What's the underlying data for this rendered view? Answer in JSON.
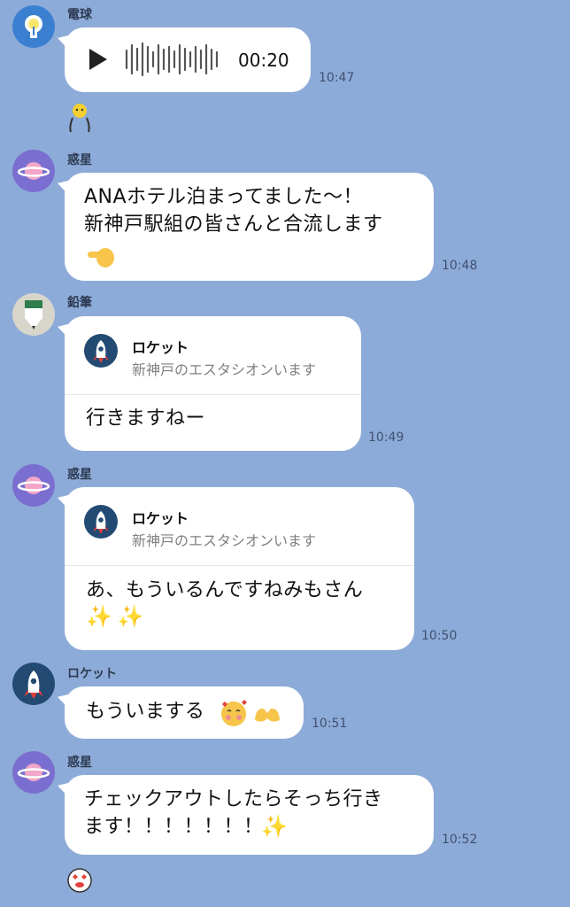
{
  "messages": [
    {
      "sender": "電球",
      "type": "voice",
      "duration": "00:20",
      "time": "10:47"
    },
    {
      "sender": "惑星",
      "type": "text",
      "text": "ANAホテル泊まってました〜！\n新神戸駅組の皆さんと合流します",
      "time": "10:48"
    },
    {
      "sender": "鉛筆",
      "type": "reply",
      "reply_name": "ロケット",
      "reply_text": "新神戸のエスタシオンいます",
      "text": "行きますねー",
      "time": "10:49"
    },
    {
      "sender": "惑星",
      "type": "reply",
      "reply_name": "ロケット",
      "reply_text": "新神戸のエスタシオンいます",
      "text": "あ、もういるんですねみもさん",
      "time": "10:50"
    },
    {
      "sender": "ロケット",
      "type": "text",
      "text": "もういまする",
      "time": "10:51"
    },
    {
      "sender": "惑星",
      "type": "text",
      "text": "チェックアウトしたらそっち行き\nます！！！！！！！",
      "time": "10:52"
    }
  ],
  "icons": {
    "bulb": "lightbulb-avatar",
    "planet": "planet-avatar",
    "pencil": "pencil-avatar",
    "rocket": "rocket-avatar"
  },
  "colors": {
    "background": "#8dabd8",
    "bubble": "#ffffff",
    "planet": "#7a6fd0",
    "bulb": "#3b7fd1",
    "rocket": "#224a73"
  }
}
